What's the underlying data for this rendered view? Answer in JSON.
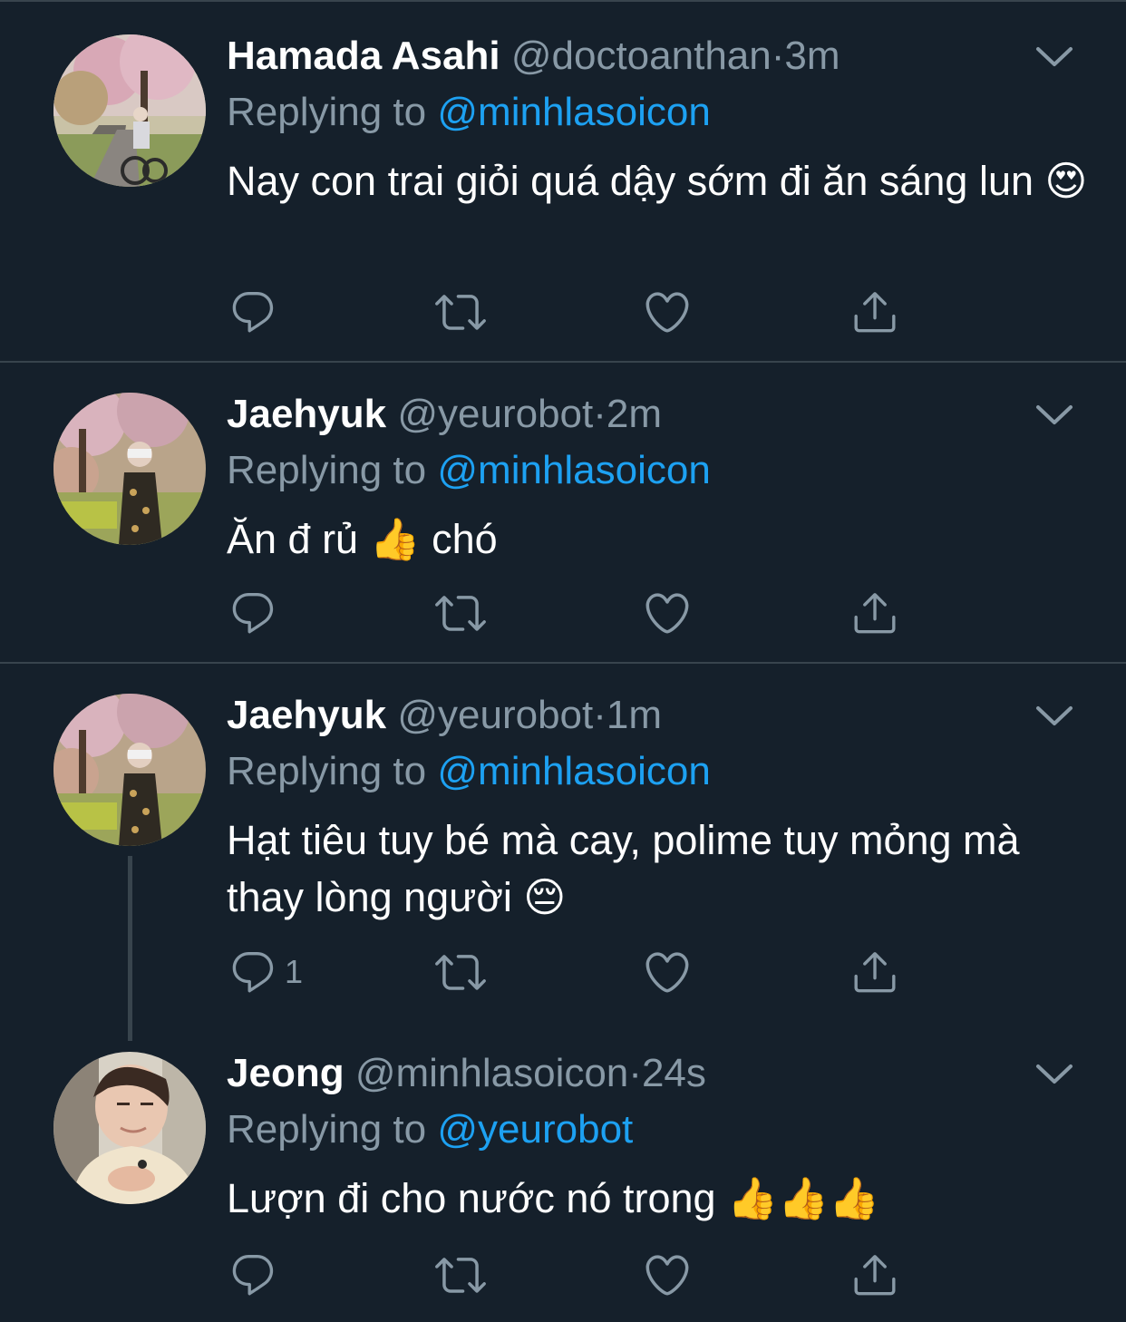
{
  "theme": {
    "background": "#15202b",
    "text": "#ffffff",
    "muted": "#8899a6",
    "accent": "#1da1f2",
    "divider": "#38444d"
  },
  "tweets": [
    {
      "display_name": "Hamada Asahi",
      "handle": "@doctoanthan",
      "separator": "·",
      "time": "3m",
      "replying_prefix": "Replying to",
      "replying_to": "@minhlasoicon",
      "text": "Nay con trai giỏi quá dậy sớm đi ăn sáng lun",
      "emoji": "😍",
      "reply_count": "",
      "icons": [
        "reply-icon",
        "retweet-icon",
        "like-icon",
        "share-icon",
        "chevron-down-icon"
      ]
    },
    {
      "display_name": "Jaehyuk",
      "handle": "@yeurobot",
      "separator": "·",
      "time": "2m",
      "replying_prefix": "Replying to",
      "replying_to": "@minhlasoicon",
      "text_before": "Ăn đ rủ",
      "emoji": "👍",
      "text_after": "chó",
      "reply_count": "",
      "icons": [
        "reply-icon",
        "retweet-icon",
        "like-icon",
        "share-icon",
        "chevron-down-icon"
      ]
    },
    {
      "display_name": "Jaehyuk",
      "handle": "@yeurobot",
      "separator": "·",
      "time": "1m",
      "replying_prefix": "Replying to",
      "replying_to": "@minhlasoicon",
      "text": "Hạt tiêu tuy bé mà cay, polime tuy mỏng mà thay lòng người",
      "emoji": "😔",
      "reply_count": "1",
      "icons": [
        "reply-icon",
        "retweet-icon",
        "like-icon",
        "share-icon",
        "chevron-down-icon"
      ]
    },
    {
      "display_name": "Jeong",
      "handle": "@minhlasoicon",
      "separator": "·",
      "time": "24s",
      "replying_prefix": "Replying to",
      "replying_to": "@yeurobot",
      "text": "Lượn đi cho nước nó trong",
      "emoji": "👍👍👍",
      "reply_count": "",
      "icons": [
        "reply-icon",
        "retweet-icon",
        "like-icon",
        "share-icon",
        "chevron-down-icon"
      ]
    }
  ]
}
